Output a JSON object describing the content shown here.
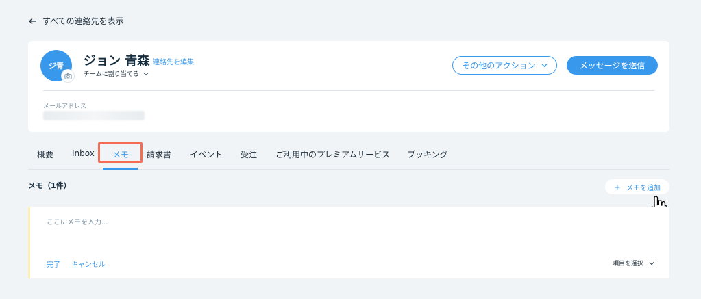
{
  "back": {
    "label": "すべての連絡先を表示"
  },
  "contact": {
    "avatar_initials": "ジ青",
    "name": "ジョン 青森",
    "edit_label": "連絡先を編集",
    "assign_label": "チームに割り当てる",
    "more_actions_label": "その他のアクション",
    "send_message_label": "メッセージを送信",
    "email_label": "メールアドレス",
    "avatar_color": "#3899ec"
  },
  "tabs": [
    {
      "label": "概要"
    },
    {
      "label": "Inbox"
    },
    {
      "label": "メモ"
    },
    {
      "label": "請求書"
    },
    {
      "label": "イベント"
    },
    {
      "label": "受注"
    },
    {
      "label": "ご利用中のプレミアムサービス"
    },
    {
      "label": "ブッキング"
    }
  ],
  "active_tab": "メモ",
  "notes": {
    "title": "メモ（1件）",
    "add_label": "メモを追加",
    "input_placeholder": "ここにメモを入力...",
    "input_value": "",
    "done_label": "完了",
    "cancel_label": "キャンセル",
    "select_label": "項目を選択"
  },
  "colors": {
    "accent": "#3899ec",
    "highlight": "#f26d52",
    "note_border": "#fdf0b0"
  }
}
